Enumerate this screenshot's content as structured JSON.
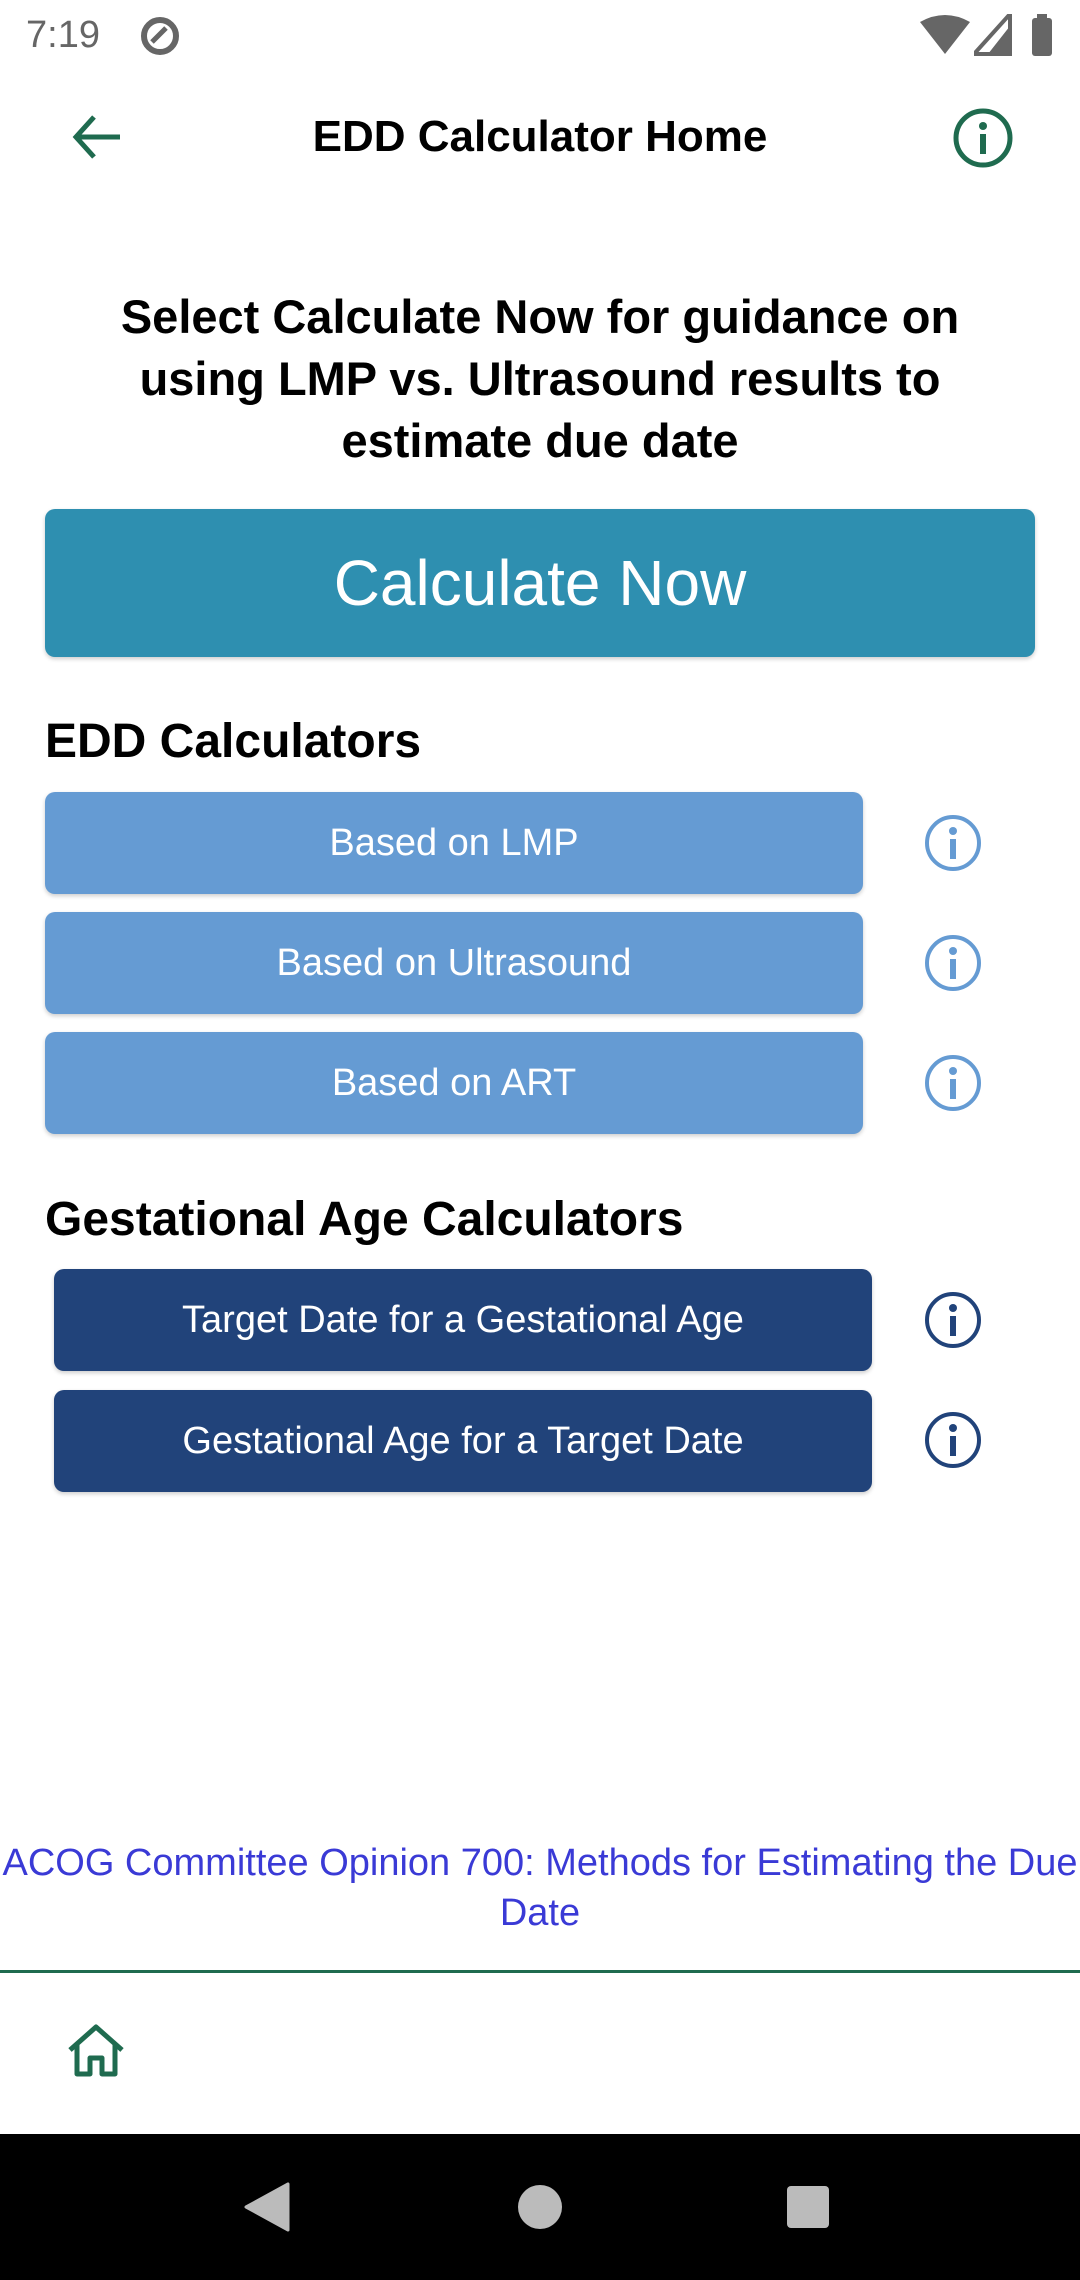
{
  "status_bar": {
    "time": "7:19"
  },
  "header": {
    "title": "EDD Calculator Home",
    "back_icon": "arrow-left-icon",
    "info_icon": "info-icon"
  },
  "intro": {
    "text": "Select Calculate Now for guidance on using LMP vs. Ultrasound results to estimate due date"
  },
  "calculate_now": {
    "label": "Calculate Now"
  },
  "edd_section": {
    "title": "EDD Calculators",
    "items": [
      {
        "label": "Based on LMP"
      },
      {
        "label": "Based on Ultrasound"
      },
      {
        "label": "Based on ART"
      }
    ]
  },
  "ga_section": {
    "title": "Gestational Age Calculators",
    "items": [
      {
        "label": "Target Date for a Gestational Age"
      },
      {
        "label": "Gestational Age for a Target Date"
      }
    ]
  },
  "footer_link": {
    "text": "ACOG Committee Opinion 700: Methods for Estimating the Due Date"
  },
  "colors": {
    "accent_green": "#1f6b4f",
    "calculate_blue": "#2e8fb0",
    "edd_blue": "#659bd3",
    "ga_navy": "#21437a",
    "link": "#3a3ad6"
  }
}
